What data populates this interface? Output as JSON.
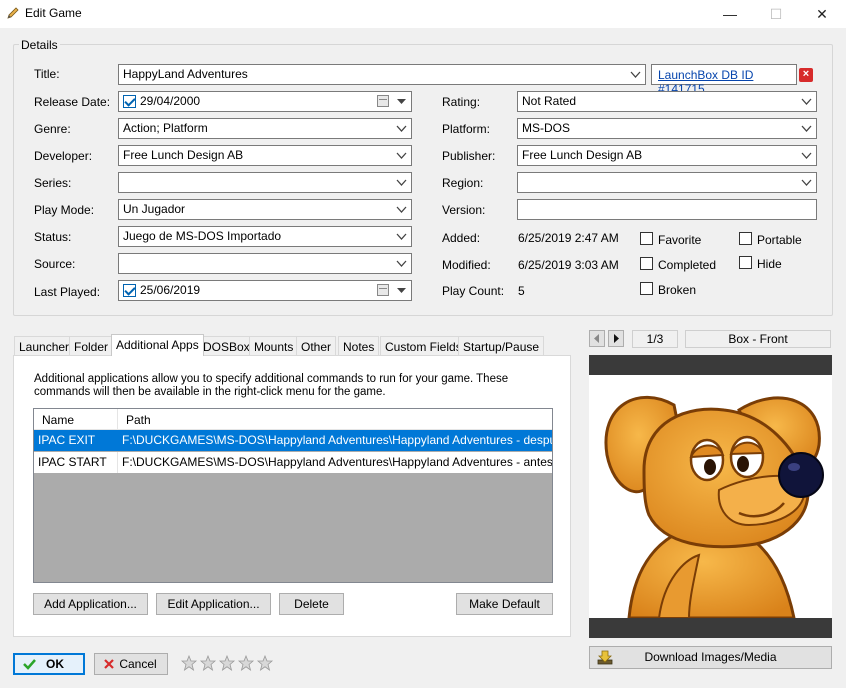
{
  "window": {
    "title": "Edit Game",
    "controls": {
      "minimize": "—",
      "maximize": "☐",
      "close": "✕"
    }
  },
  "details": {
    "group_label": "Details",
    "title_label": "Title:",
    "title_value": "HappyLand Adventures",
    "launchbox_link": "LaunchBox DB ID #141715",
    "release_date_label": "Release Date:",
    "release_date_value": "29/04/2000",
    "genre_label": "Genre:",
    "genre_value": "Action; Platform",
    "developer_label": "Developer:",
    "developer_value": "Free Lunch Design AB",
    "series_label": "Series:",
    "series_value": "",
    "play_mode_label": "Play Mode:",
    "play_mode_value": "Un Jugador",
    "status_label": "Status:",
    "status_value": "Juego de MS-DOS Importado",
    "source_label": "Source:",
    "source_value": "",
    "last_played_label": "Last Played:",
    "last_played_value": "25/06/2019",
    "rating_label": "Rating:",
    "rating_value": "Not Rated",
    "platform_label": "Platform:",
    "platform_value": "MS-DOS",
    "publisher_label": "Publisher:",
    "publisher_value": "Free Lunch Design AB",
    "region_label": "Region:",
    "region_value": "",
    "version_label": "Version:",
    "version_value": "",
    "added_label": "Added:",
    "added_value": "6/25/2019 2:47 AM",
    "modified_label": "Modified:",
    "modified_value": "6/25/2019 3:03 AM",
    "play_count_label": "Play Count:",
    "play_count_value": "5",
    "checkboxes": {
      "favorite": "Favorite",
      "portable": "Portable",
      "completed": "Completed",
      "hide": "Hide",
      "broken": "Broken"
    }
  },
  "tabs": [
    "Launcher",
    "Folder",
    "Additional Apps",
    "DOSBox",
    "Mounts",
    "Other",
    "Notes",
    "Custom Fields",
    "Startup/Pause"
  ],
  "active_tab": "Additional Apps",
  "additional_apps": {
    "description": "Additional applications allow you to specify additional commands to run for your game.  These commands will then be available in the right-click menu for the game.",
    "columns": [
      "Name",
      "Path"
    ],
    "rows": [
      {
        "name": "IPAC EXIT",
        "path": "F:\\DUCKGAMES\\MS-DOS\\Happyland Adventures\\Happyland Adventures - despues.bat",
        "selected": true
      },
      {
        "name": "IPAC START",
        "path": "F:\\DUCKGAMES\\MS-DOS\\Happyland Adventures\\Happyland Adventures - antes.bat",
        "selected": false
      }
    ],
    "buttons": {
      "add": "Add Application...",
      "edit": "Edit Application...",
      "delete": "Delete",
      "make_default": "Make Default"
    }
  },
  "image_panel": {
    "counter": "1/3",
    "image_type": "Box - Front",
    "download_label": "Download Images/Media"
  },
  "footer": {
    "ok_label": "OK",
    "cancel_label": "Cancel",
    "star_rating": 0,
    "star_max": 5
  },
  "colors": {
    "selection": "#0078d7",
    "link": "#0645ad",
    "default_button_border": "#0078d7"
  }
}
